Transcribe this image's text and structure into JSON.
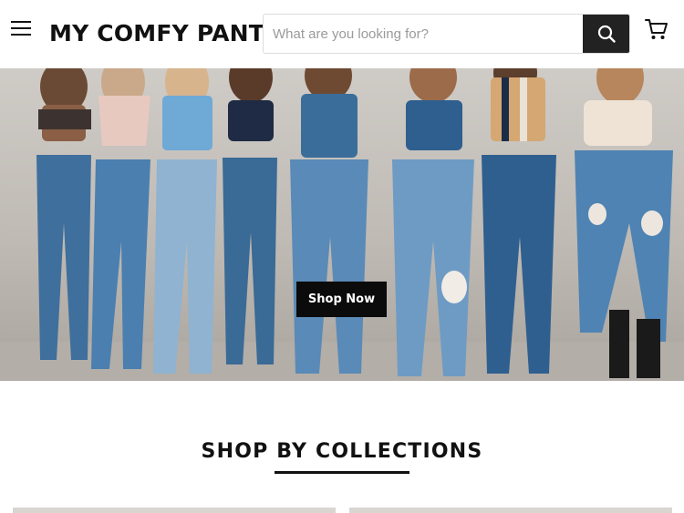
{
  "header": {
    "logo_text": "MY COMFY PANT",
    "search_placeholder": "What are you looking for?",
    "menu_icon": "hamburger-menu-icon",
    "search_icon": "search-icon",
    "cart_icon": "shopping-cart-icon"
  },
  "hero": {
    "cta_label": "Shop Now"
  },
  "collections": {
    "title": "SHOP BY COLLECTIONS"
  },
  "colors": {
    "text": "#111111",
    "cta_bg": "#0b0b0b",
    "search_button_bg": "#222222",
    "denim": "#4a78a3"
  }
}
